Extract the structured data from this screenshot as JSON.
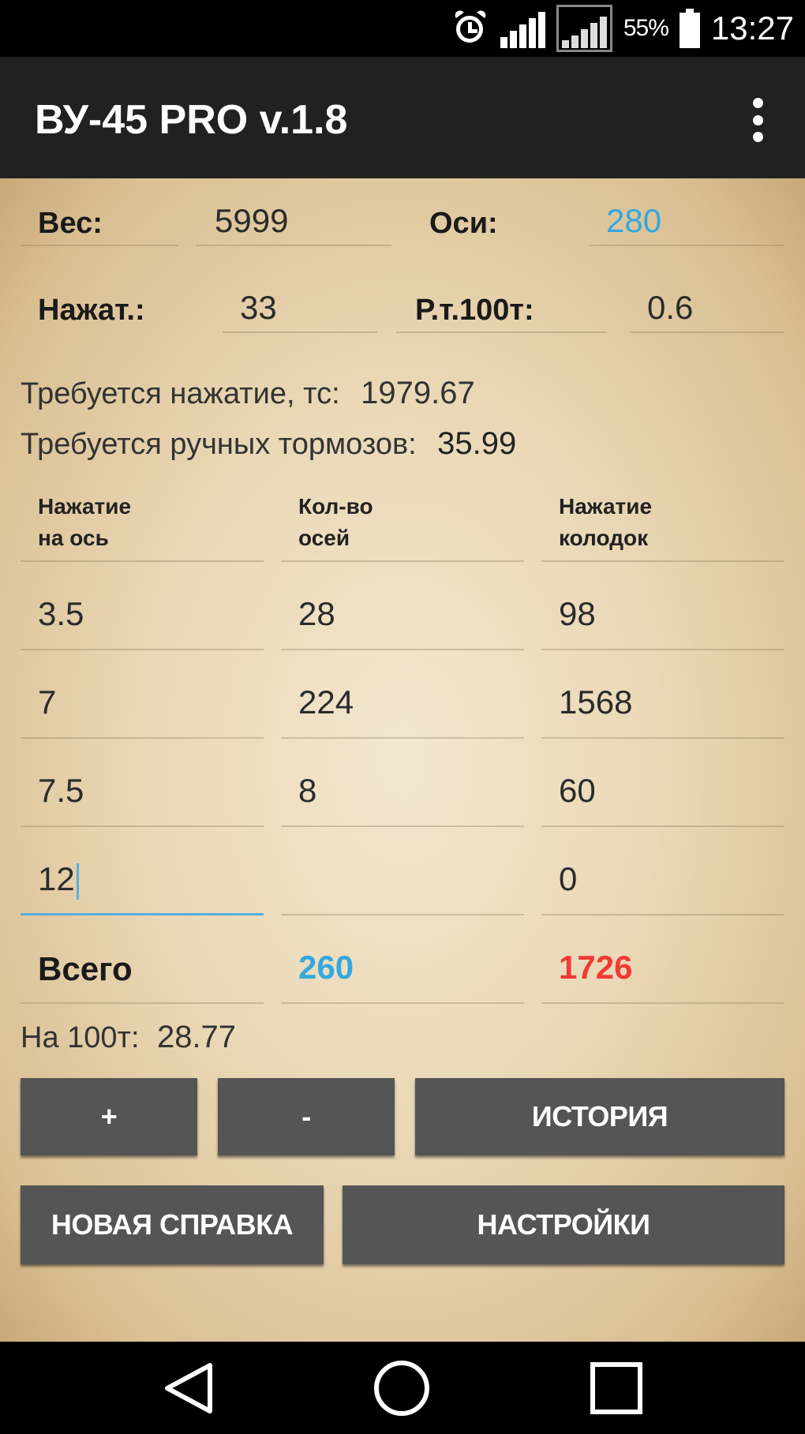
{
  "status_bar": {
    "battery_percent": "55%",
    "time": "13:27",
    "icons": [
      "alarm-icon",
      "signal-icon",
      "signal-icon",
      "battery-icon"
    ]
  },
  "action_bar": {
    "title": "ВУ-45 PRO v.1.8",
    "menu_icon": "overflow-menu-icon"
  },
  "inputs": {
    "weight_label": "Вес:",
    "weight_value": "5999",
    "axles_label": "Оси:",
    "axles_value": "280",
    "press_label": "Нажат.:",
    "press_value": "33",
    "rt100_label": "Р.т.100т:",
    "rt100_value": "0.6"
  },
  "results": {
    "required_press_label": "Требуется нажатие, тс:",
    "required_press_value": "1979.67",
    "required_hand_label": "Требуется ручных тормозов:",
    "required_hand_value": "35.99"
  },
  "table": {
    "headers": [
      [
        "Нажатие",
        "на ось"
      ],
      [
        "Кол-во",
        "осей"
      ],
      [
        "Нажатие",
        "колодок"
      ]
    ],
    "rows": [
      [
        "3.5",
        "28",
        "98"
      ],
      [
        "7",
        "224",
        "1568"
      ],
      [
        "7.5",
        "8",
        "60"
      ],
      [
        "12",
        "",
        "0"
      ]
    ],
    "total_label": "Всего",
    "total_axles": "260",
    "total_press": "1726"
  },
  "per100": {
    "label": "На 100т:",
    "value": "28.77"
  },
  "buttons": {
    "plus": "+",
    "minus": "-",
    "history": "ИСТОРИЯ",
    "new_ref": "НОВАЯ СПРАВКА",
    "settings": "НАСТРОЙКИ"
  },
  "colors": {
    "blue": "#33a8e0",
    "red": "#f23a35",
    "button": "#555555",
    "toolbar": "#212121"
  }
}
